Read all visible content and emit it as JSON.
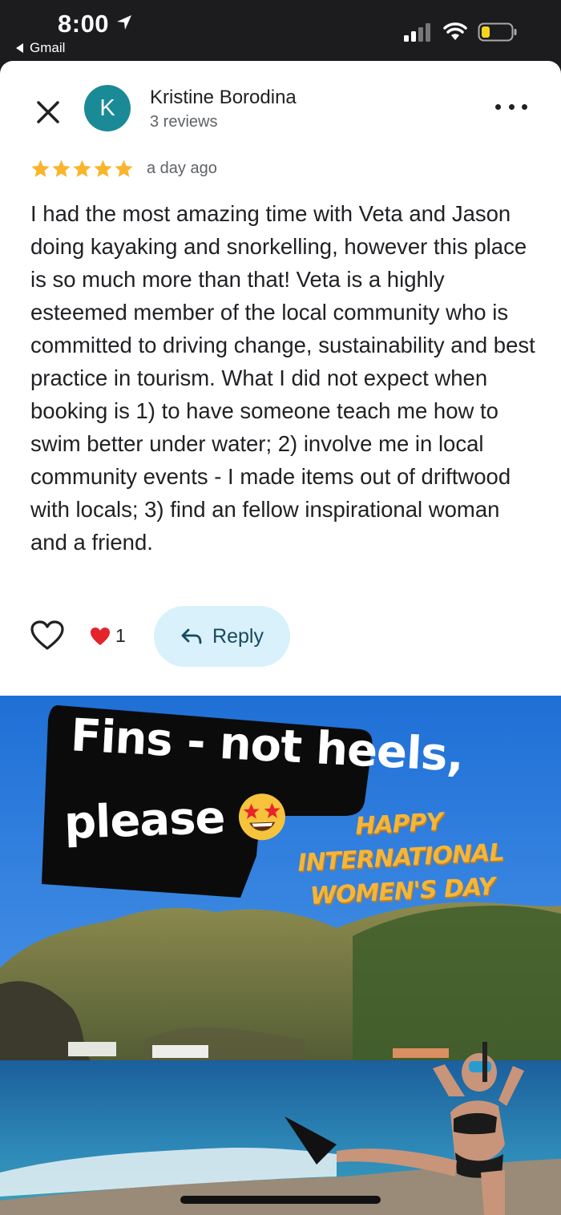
{
  "status_bar": {
    "time": "8:00",
    "back_app": "Gmail",
    "icons": [
      "location-arrow-icon",
      "cellular-signal-icon",
      "wifi-icon",
      "battery-low-icon"
    ]
  },
  "review": {
    "author_initial": "K",
    "author_name": "Kristine Borodina",
    "author_reviews": "3 reviews",
    "rating": 5,
    "date": "a day ago",
    "text": "I had the most amazing time with Veta and Jason doing kayaking and snorkelling, however this place is so much more than that! Veta is a highly esteemed member of the local community who is committed to driving change, sustainability and best practice in tourism. What I did not expect when booking is 1) to have someone teach me how to swim better under water; 2) involve me in local community events - I made items out of driftwood with locals; 3) find an fellow inspirational woman and a friend.",
    "reaction_count": "1",
    "reply_label": "Reply"
  },
  "photo": {
    "sticker_line1": "Fins - not heels,",
    "sticker_line2": "please",
    "overlay_text": "HAPPY INTERNATIONAL WOMEN'S DAY"
  },
  "colors": {
    "avatar": "#1a8a96",
    "star": "#f9b52c",
    "reply_bg": "#d9f1fb",
    "reply_text": "#174a5e",
    "overlay_text": "#f4b63a"
  }
}
